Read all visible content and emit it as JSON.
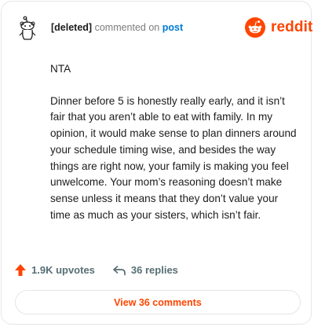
{
  "header": {
    "username": "[deleted]",
    "action_text": "commented on",
    "post_link": "post"
  },
  "logo": {
    "icon": "reddit-snoo-icon",
    "wordmark": "reddit",
    "brand_color": "#ff4500"
  },
  "comment": {
    "paragraphs": [
      "NTA",
      "Dinner before 5 is honestly really early, and it isn’t fair that you aren’t able to eat with family. In my opinion, it would make sense to plan dinners around your schedule timing wise, and besides the way things are right now, your family is making you feel unwelcome. Your mom’s reasoning doesn’t make sense unless it means that they don’t value your time as much as your sisters, which isn’t fair."
    ]
  },
  "stats": {
    "upvotes": "1.9K upvotes",
    "replies": "36 replies",
    "upvote_icon": "upvote-arrow-icon",
    "reply_icon": "reply-arrow-icon",
    "upvote_color": "#ff4500"
  },
  "footer": {
    "view_button_label": "View 36 comments"
  }
}
